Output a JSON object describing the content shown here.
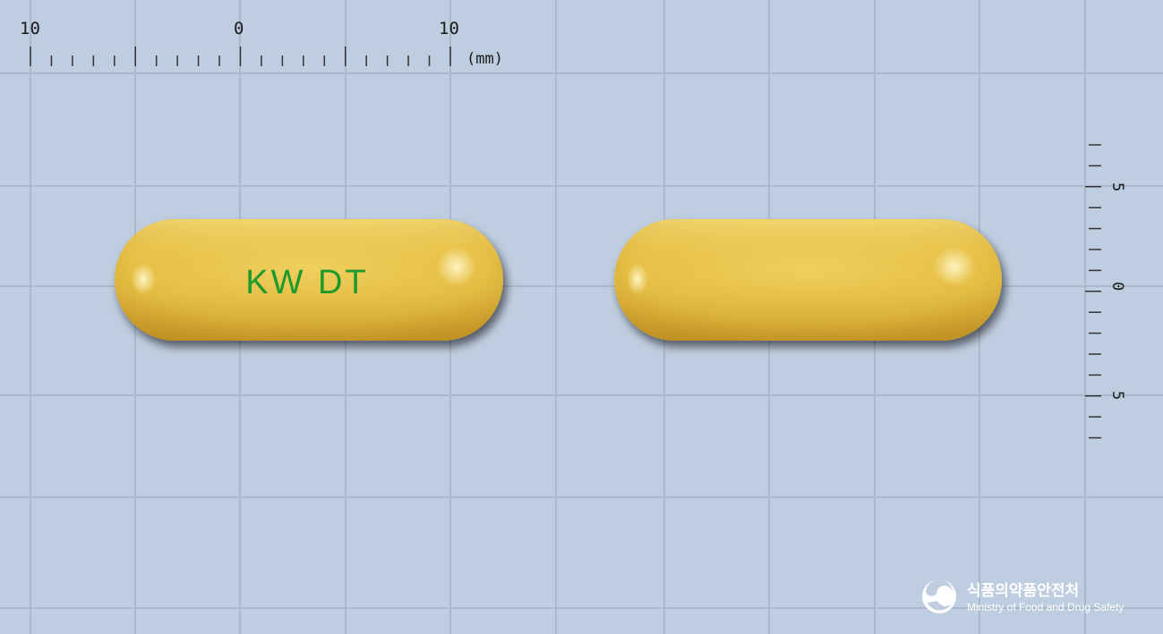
{
  "ruler_top": {
    "label_left": "10",
    "label_center": "0",
    "label_right": "10",
    "unit": "(mm)"
  },
  "ruler_right": {
    "label_top": "5",
    "label_center": "0",
    "label_bottom": "5"
  },
  "pills": [
    {
      "imprint": "KW DT",
      "color": "#e9c34a"
    },
    {
      "imprint": "",
      "color": "#e9c34a"
    }
  ],
  "background_color": "#bfcde0",
  "imprint_color": "#1d9a2a",
  "logo": {
    "korean_name": "식품의약품안전처",
    "english_name": "Ministry of Food and Drug Safety"
  }
}
